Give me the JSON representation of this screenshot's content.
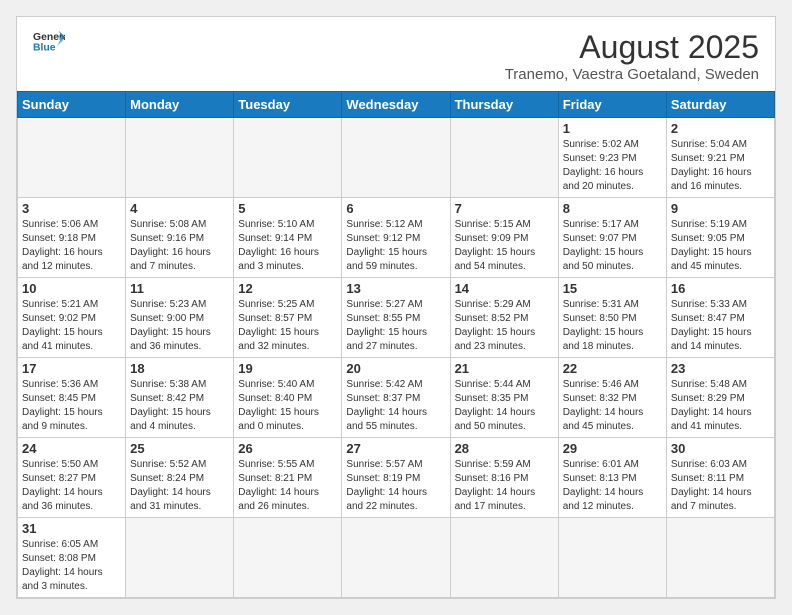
{
  "header": {
    "logo_line1": "General",
    "logo_line2": "Blue",
    "month": "August 2025",
    "location": "Tranemo, Vaestra Goetaland, Sweden"
  },
  "weekdays": [
    "Sunday",
    "Monday",
    "Tuesday",
    "Wednesday",
    "Thursday",
    "Friday",
    "Saturday"
  ],
  "weeks": [
    [
      {
        "day": "",
        "info": ""
      },
      {
        "day": "",
        "info": ""
      },
      {
        "day": "",
        "info": ""
      },
      {
        "day": "",
        "info": ""
      },
      {
        "day": "",
        "info": ""
      },
      {
        "day": "1",
        "info": "Sunrise: 5:02 AM\nSunset: 9:23 PM\nDaylight: 16 hours and 20 minutes."
      },
      {
        "day": "2",
        "info": "Sunrise: 5:04 AM\nSunset: 9:21 PM\nDaylight: 16 hours and 16 minutes."
      }
    ],
    [
      {
        "day": "3",
        "info": "Sunrise: 5:06 AM\nSunset: 9:18 PM\nDaylight: 16 hours and 12 minutes."
      },
      {
        "day": "4",
        "info": "Sunrise: 5:08 AM\nSunset: 9:16 PM\nDaylight: 16 hours and 7 minutes."
      },
      {
        "day": "5",
        "info": "Sunrise: 5:10 AM\nSunset: 9:14 PM\nDaylight: 16 hours and 3 minutes."
      },
      {
        "day": "6",
        "info": "Sunrise: 5:12 AM\nSunset: 9:12 PM\nDaylight: 15 hours and 59 minutes."
      },
      {
        "day": "7",
        "info": "Sunrise: 5:15 AM\nSunset: 9:09 PM\nDaylight: 15 hours and 54 minutes."
      },
      {
        "day": "8",
        "info": "Sunrise: 5:17 AM\nSunset: 9:07 PM\nDaylight: 15 hours and 50 minutes."
      },
      {
        "day": "9",
        "info": "Sunrise: 5:19 AM\nSunset: 9:05 PM\nDaylight: 15 hours and 45 minutes."
      }
    ],
    [
      {
        "day": "10",
        "info": "Sunrise: 5:21 AM\nSunset: 9:02 PM\nDaylight: 15 hours and 41 minutes."
      },
      {
        "day": "11",
        "info": "Sunrise: 5:23 AM\nSunset: 9:00 PM\nDaylight: 15 hours and 36 minutes."
      },
      {
        "day": "12",
        "info": "Sunrise: 5:25 AM\nSunset: 8:57 PM\nDaylight: 15 hours and 32 minutes."
      },
      {
        "day": "13",
        "info": "Sunrise: 5:27 AM\nSunset: 8:55 PM\nDaylight: 15 hours and 27 minutes."
      },
      {
        "day": "14",
        "info": "Sunrise: 5:29 AM\nSunset: 8:52 PM\nDaylight: 15 hours and 23 minutes."
      },
      {
        "day": "15",
        "info": "Sunrise: 5:31 AM\nSunset: 8:50 PM\nDaylight: 15 hours and 18 minutes."
      },
      {
        "day": "16",
        "info": "Sunrise: 5:33 AM\nSunset: 8:47 PM\nDaylight: 15 hours and 14 minutes."
      }
    ],
    [
      {
        "day": "17",
        "info": "Sunrise: 5:36 AM\nSunset: 8:45 PM\nDaylight: 15 hours and 9 minutes."
      },
      {
        "day": "18",
        "info": "Sunrise: 5:38 AM\nSunset: 8:42 PM\nDaylight: 15 hours and 4 minutes."
      },
      {
        "day": "19",
        "info": "Sunrise: 5:40 AM\nSunset: 8:40 PM\nDaylight: 15 hours and 0 minutes."
      },
      {
        "day": "20",
        "info": "Sunrise: 5:42 AM\nSunset: 8:37 PM\nDaylight: 14 hours and 55 minutes."
      },
      {
        "day": "21",
        "info": "Sunrise: 5:44 AM\nSunset: 8:35 PM\nDaylight: 14 hours and 50 minutes."
      },
      {
        "day": "22",
        "info": "Sunrise: 5:46 AM\nSunset: 8:32 PM\nDaylight: 14 hours and 45 minutes."
      },
      {
        "day": "23",
        "info": "Sunrise: 5:48 AM\nSunset: 8:29 PM\nDaylight: 14 hours and 41 minutes."
      }
    ],
    [
      {
        "day": "24",
        "info": "Sunrise: 5:50 AM\nSunset: 8:27 PM\nDaylight: 14 hours and 36 minutes."
      },
      {
        "day": "25",
        "info": "Sunrise: 5:52 AM\nSunset: 8:24 PM\nDaylight: 14 hours and 31 minutes."
      },
      {
        "day": "26",
        "info": "Sunrise: 5:55 AM\nSunset: 8:21 PM\nDaylight: 14 hours and 26 minutes."
      },
      {
        "day": "27",
        "info": "Sunrise: 5:57 AM\nSunset: 8:19 PM\nDaylight: 14 hours and 22 minutes."
      },
      {
        "day": "28",
        "info": "Sunrise: 5:59 AM\nSunset: 8:16 PM\nDaylight: 14 hours and 17 minutes."
      },
      {
        "day": "29",
        "info": "Sunrise: 6:01 AM\nSunset: 8:13 PM\nDaylight: 14 hours and 12 minutes."
      },
      {
        "day": "30",
        "info": "Sunrise: 6:03 AM\nSunset: 8:11 PM\nDaylight: 14 hours and 7 minutes."
      }
    ],
    [
      {
        "day": "31",
        "info": "Sunrise: 6:05 AM\nSunset: 8:08 PM\nDaylight: 14 hours and 3 minutes."
      },
      {
        "day": "",
        "info": ""
      },
      {
        "day": "",
        "info": ""
      },
      {
        "day": "",
        "info": ""
      },
      {
        "day": "",
        "info": ""
      },
      {
        "day": "",
        "info": ""
      },
      {
        "day": "",
        "info": ""
      }
    ]
  ]
}
